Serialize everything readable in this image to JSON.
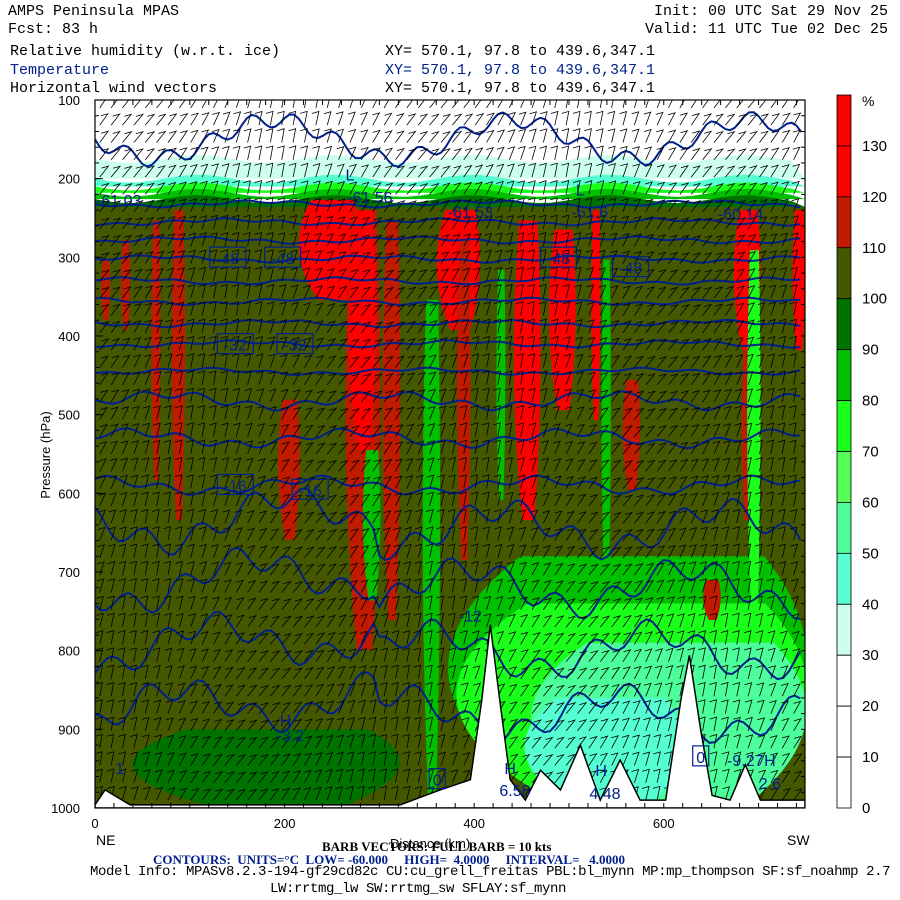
{
  "header": {
    "model": "AMPS Peninsula MPAS",
    "init": "Init: 00 UTC Sat 29 Nov 25",
    "fcst": "Fcst:   83 h",
    "valid": "Valid: 11 UTC Tue 02 Dec 25",
    "fields": [
      {
        "name": "Relative humidity (w.r.t. ice)",
        "xy": "XY= 570.1, 97.8 to 439.6,347.1",
        "color": "#000000"
      },
      {
        "name": "Temperature",
        "xy": "XY= 570.1, 97.8 to 439.6,347.1",
        "color": "#00208c"
      },
      {
        "name": "Horizontal wind vectors",
        "xy": "XY= 570.1, 97.8 to 439.6,347.1",
        "color": "#000000"
      }
    ]
  },
  "footer": {
    "ne": "NE",
    "sw": "SW",
    "barb": "BARB VECTORS: FULL BARB = 10 kts",
    "contours": "CONTOURS:  UNITS=°C  LOW= -60.000     HIGH=  4.0000     INTERVAL=   4.0000",
    "model_info": "Model Info: MPASv8.2.3-194-gf29cd82c CU:cu_grell_freitas PBL:bl_mynn MP:mp_thompson SF:sf_noahmp 2.7",
    "model_info2": "LW:rrtmg_lw SW:rrtmg_sw SFLAY:sf_mynn"
  },
  "chart_data": {
    "type": "heatmap",
    "title": "Cross-section: Relative humidity (w.r.t. ice), Temperature, Horizontal wind vectors",
    "xlabel": "Distance (km)",
    "ylabel": "Pressure (hPa)",
    "xlim": [
      0,
      749
    ],
    "ylim": [
      100,
      1000
    ],
    "y_inverted": true,
    "xticks": [
      "0",
      "200",
      "400",
      "600"
    ],
    "xtick_values": [
      0,
      200,
      400,
      600
    ],
    "yticks": [
      "100",
      "200",
      "300",
      "400",
      "500",
      "600",
      "700",
      "800",
      "900",
      "1000"
    ],
    "ytick_values": [
      100,
      200,
      300,
      400,
      500,
      600,
      700,
      800,
      900,
      1000
    ],
    "colorbar": {
      "unit": "%",
      "labels": [
        "130",
        "120",
        "110",
        "100",
        "90",
        "80",
        "70",
        "60",
        "50",
        "40",
        "30",
        "20",
        "10",
        "0"
      ],
      "colors": [
        "#ff0000",
        "#ff0000",
        "#c01a00",
        "#455800",
        "#007200",
        "#00c000",
        "#1aff1a",
        "#55ff55",
        "#4dff9a",
        "#55ffd2",
        "#ccffee",
        "#ffffff",
        "#ffffff",
        "#ffffff",
        "#ffffff"
      ]
    },
    "rh_bands_top": [
      {
        "p": [
          175,
          200
        ],
        "rh": 35
      },
      {
        "p": [
          200,
          210
        ],
        "rh": 45
      },
      {
        "p": [
          210,
          218
        ],
        "rh": 75
      },
      {
        "p": [
          218,
          226
        ],
        "rh": 85
      },
      {
        "p": [
          226,
          236
        ],
        "rh": 95
      }
    ],
    "rh_background": 105,
    "rh_regions": [
      {
        "km": [
          0,
          320
        ],
        "p": [
          900,
          1000
        ],
        "rh": 95
      },
      {
        "km": [
          320,
          749
        ],
        "p": [
          680,
          1000
        ],
        "rh": 85
      },
      {
        "km": [
          330,
          749
        ],
        "p": [
          740,
          1000
        ],
        "rh": 75
      },
      {
        "km": [
          420,
          749
        ],
        "p": [
          790,
          1000
        ],
        "rh": 55
      },
      {
        "km": [
          430,
          620
        ],
        "p": [
          860,
          1000
        ],
        "rh": 45
      },
      {
        "km": [
          5,
          16
        ],
        "p": [
          303,
          380
        ],
        "rh": 115
      },
      {
        "km": [
          26,
          37
        ],
        "p": [
          278,
          392
        ],
        "rh": 115
      },
      {
        "km": [
          58,
          69
        ],
        "p": [
          253,
          583
        ],
        "rh": 115
      },
      {
        "km": [
          79,
          95
        ],
        "p": [
          240,
          634
        ],
        "rh": 115
      },
      {
        "km": [
          190,
          216
        ],
        "p": [
          481,
          659
        ],
        "rh": 115
      },
      {
        "km": [
          206,
          280
        ],
        "p": [
          227,
          354
        ],
        "rh": 125
      },
      {
        "km": [
          259,
          301
        ],
        "p": [
          240,
          799
        ],
        "rh": 115
      },
      {
        "km": [
          264,
          296
        ],
        "p": [
          240,
          545
        ],
        "rh": 125
      },
      {
        "km": [
          301,
          322
        ],
        "p": [
          253,
          761
        ],
        "rh": 115
      },
      {
        "km": [
          354,
          406
        ],
        "p": [
          240,
          392
        ],
        "rh": 125
      },
      {
        "km": [
          380,
          396
        ],
        "p": [
          278,
          685
        ],
        "rh": 115
      },
      {
        "km": [
          438,
          470
        ],
        "p": [
          253,
          634
        ],
        "rh": 125
      },
      {
        "km": [
          475,
          507
        ],
        "p": [
          265,
          494
        ],
        "rh": 125
      },
      {
        "km": [
          522,
          533
        ],
        "p": [
          240,
          507
        ],
        "rh": 125
      },
      {
        "km": [
          554,
          575
        ],
        "p": [
          456,
          596
        ],
        "rh": 115
      },
      {
        "km": [
          639,
          660
        ],
        "p": [
          710,
          761
        ],
        "rh": 115
      },
      {
        "km": [
          670,
          702
        ],
        "p": [
          240,
          418
        ],
        "rh": 125
      },
      {
        "km": [
          681,
          691
        ],
        "p": [
          418,
          634
        ],
        "rh": 115
      },
      {
        "km": [
          734,
          749
        ],
        "p": [
          240,
          418
        ],
        "rh": 125
      },
      {
        "km": [
          343,
          364
        ],
        "p": [
          354,
          990
        ],
        "rh": 85
      },
      {
        "km": [
          422,
          433
        ],
        "p": [
          316,
          608
        ],
        "rh": 85
      },
      {
        "km": [
          533,
          544
        ],
        "p": [
          303,
          736
        ],
        "rh": 85
      },
      {
        "km": [
          686,
          702
        ],
        "p": [
          291,
          761
        ],
        "rh": 75
      },
      {
        "km": [
          280,
          301
        ],
        "p": [
          545,
          736
        ],
        "rh": 85
      }
    ],
    "terrain": {
      "km": [
        0,
        10.6,
        37,
        322,
        364,
        396,
        408,
        417,
        427,
        438,
        454,
        470,
        491,
        512,
        533,
        554,
        575,
        602,
        618,
        627,
        639,
        651,
        670,
        686,
        702,
        749
      ],
      "hPa": [
        996,
        977,
        996,
        996,
        977,
        964,
        863,
        767,
        863,
        964,
        990,
        952,
        977,
        920,
        990,
        939,
        990,
        990,
        863,
        806,
        901,
        984,
        990,
        945,
        990,
        990
      ]
    },
    "temperature_contours": {
      "units": "°C",
      "low": -60,
      "high": 4,
      "interval": 4,
      "levels": [
        -60,
        -56,
        -52,
        -48,
        -44,
        -40,
        -36,
        -32,
        -28,
        -24,
        -20,
        -16,
        -12,
        -8,
        -4,
        0
      ],
      "approx_pressure": [
        232,
        255,
        278,
        302,
        330,
        356,
        384,
        410,
        445,
        482,
        530,
        590,
        645,
        720,
        800,
        880
      ]
    },
    "contour_labels": [
      {
        "text": "-48",
        "km": 140,
        "p": 301,
        "boxed": true
      },
      {
        "text": "-48",
        "km": 198,
        "p": 301,
        "boxed": true
      },
      {
        "text": "-48",
        "km": 489,
        "p": 301,
        "boxed": true
      },
      {
        "text": "-48",
        "km": 565,
        "p": 313,
        "boxed": true
      },
      {
        "text": "-32",
        "km": 148,
        "p": 411,
        "boxed": true
      },
      {
        "text": "-32",
        "km": 211,
        "p": 411,
        "boxed": true
      },
      {
        "text": "-16",
        "km": 148,
        "p": 590,
        "boxed": true
      },
      {
        "text": "-16",
        "km": 227,
        "p": 596,
        "boxed": true
      },
      {
        "text": "0",
        "km": 361,
        "p": 964,
        "boxed": true
      },
      {
        "text": "0",
        "km": 639,
        "p": 935,
        "boxed": true
      },
      {
        "text": "-61.03",
        "km": 25,
        "p": 227,
        "boxed": false
      },
      {
        "text": "-61.56",
        "km": 290,
        "p": 223,
        "boxed": false
      },
      {
        "text": "-61.53",
        "km": 396,
        "p": 242,
        "boxed": false
      },
      {
        "text": "-61.6",
        "km": 522,
        "p": 242,
        "boxed": false
      },
      {
        "text": "-60.14",
        "km": 681,
        "p": 244,
        "boxed": false
      },
      {
        "text": "-12",
        "km": 396,
        "p": 755,
        "boxed": false
      },
      {
        "text": "-3.2",
        "km": 206,
        "p": 907,
        "boxed": false
      },
      {
        "text": "6.58",
        "km": 443,
        "p": 977,
        "boxed": false
      },
      {
        "text": "4.48",
        "km": 538,
        "p": 981,
        "boxed": false
      },
      {
        "text": "-9.27",
        "km": 686,
        "p": 939,
        "boxed": false
      },
      {
        "text": "2.6",
        "km": 712,
        "p": 968,
        "boxed": false
      },
      {
        "text": "1",
        "km": 26,
        "p": 949,
        "boxed": false
      },
      {
        "text": "H",
        "km": 201,
        "p": 888,
        "boxed": false
      },
      {
        "text": "H",
        "km": 438,
        "p": 949,
        "boxed": false
      },
      {
        "text": "H",
        "km": 534,
        "p": 952,
        "boxed": false
      },
      {
        "text": "H",
        "km": 712,
        "p": 939,
        "boxed": false
      },
      {
        "text": "L",
        "km": 269,
        "p": 195,
        "boxed": false
      },
      {
        "text": "L",
        "km": 512,
        "p": 214,
        "boxed": false
      }
    ]
  }
}
